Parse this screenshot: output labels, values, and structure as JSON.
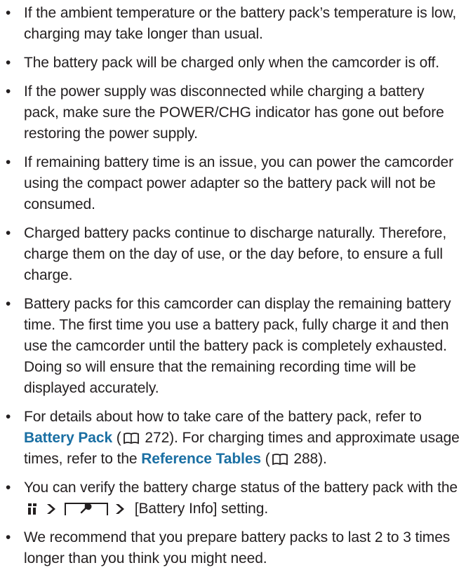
{
  "notes": [
    {
      "text": "If the ambient temperature or the battery pack’s temperature is low, charging may take longer than usual."
    },
    {
      "text": "The battery pack will be charged only when the camcorder is off."
    },
    {
      "text": "If the power supply was disconnected while charging a battery pack, make sure the POWER/CHG indicator has gone out before restoring the power supply."
    },
    {
      "text": "If remaining battery time is an issue, you can power the camcorder using the compact power adapter so the battery pack will not be consumed."
    },
    {
      "text": "Charged battery packs continue to discharge naturally. Therefore, charge them on the day of use, or the day before, to ensure a full charge."
    },
    {
      "text": "Battery packs for this camcorder can display the remaining battery time. The first time you use a battery pack, fully charge it and then use the camcorder until the battery pack is completely exhausted. Doing so will ensure that the remaining recording time will be displayed accurately."
    },
    {
      "part1": "For details about how to take care of the battery pack, refer to ",
      "link1": "Battery Pack",
      "open1": " (",
      "page1": " 272). For charging times and approximate usage times, refer to the ",
      "link2": "Reference Tables",
      "open2": " (",
      "page2": " 288)."
    },
    {
      "part1": "You can verify the battery charge status of the battery pack with the",
      "part2": "[Battery Info] setting."
    },
    {
      "text": "We recommend that you prepare battery packs to last 2 to 3 times longer than you think you might need."
    }
  ],
  "bullet": "•",
  "colors": {
    "text": "#231f20",
    "link": "#1a6fa3"
  },
  "icons": [
    "book-reference-icon",
    "menu-icon",
    "arrow-right-icon",
    "setup-wrench-tab-icon"
  ]
}
